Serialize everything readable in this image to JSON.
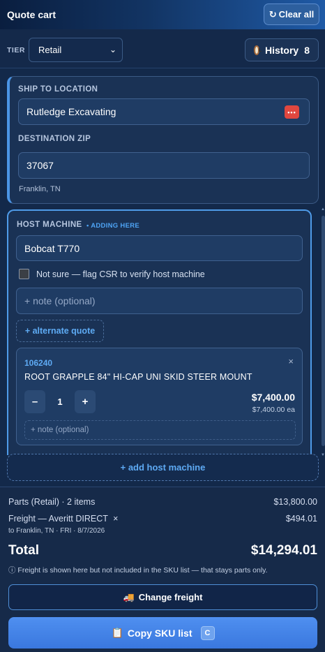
{
  "header": {
    "title": "Quote cart",
    "clear_all": "Clear all",
    "refresh_icon": "↻"
  },
  "tier": {
    "label": "TIER",
    "selected": "Retail",
    "history_label": "History",
    "history_count": "8"
  },
  "ship": {
    "label": "SHIP TO LOCATION",
    "location": "Rutledge Excavating",
    "zip_label": "DESTINATION ZIP",
    "zip": "37067",
    "city": "Franklin, TN",
    "contact_icon": "•••"
  },
  "host": {
    "label": "HOST MACHINE",
    "adding": "• ADDING HERE",
    "machine": "Bobcat T770",
    "verify_text": "Not sure — flag CSR to verify host machine",
    "note_placeholder": "+ note (optional)",
    "alternate": "+ alternate quote",
    "item": {
      "sku": "106240",
      "name": "ROOT GRAPPLE 84\" HI-CAP UNI SKID STEER MOUNT",
      "qty": "1",
      "price": "$7,400.00",
      "unit_price": "$7,400.00 ea",
      "note_placeholder": "+ note (optional)",
      "close": "×",
      "minus": "–",
      "plus": "+"
    },
    "add_host": "+ add host machine"
  },
  "summary": {
    "parts_label": "Parts (Retail) · 2 items",
    "parts_value": "$13,800.00",
    "freight_label": "Freight — Averitt DIRECT",
    "freight_remove": "×",
    "freight_value": "$494.01",
    "freight_sub": "to Franklin, TN · FRI · 8/7/2026",
    "total_label": "Total",
    "total_value": "$14,294.01",
    "info": "ⓘ Freight is shown here but not included in the SKU list — that stays parts only.",
    "change_freight": "Change freight",
    "copy_sku": "Copy SKU list",
    "copy_key": "C"
  }
}
